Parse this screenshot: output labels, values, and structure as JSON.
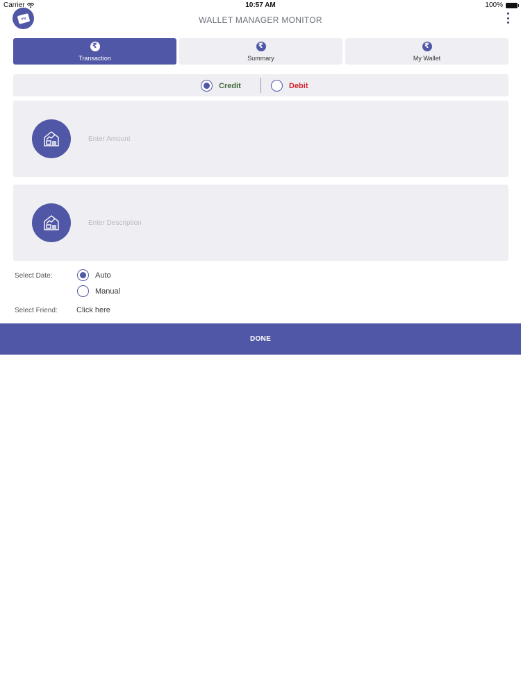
{
  "status_bar": {
    "carrier": "Carrier",
    "time": "10:57 AM",
    "battery": "100%",
    "wifi_icon": "wifi-icon",
    "battery_icon": "battery-icon"
  },
  "nav": {
    "logo_text": "my",
    "title": "WALLET MANAGER MONITOR",
    "menu_icon": "more-vertical-icon"
  },
  "tabs": [
    {
      "label": "Transaction",
      "icon": "rupee-icon",
      "icon_glyph": "₹",
      "active": true
    },
    {
      "label": "Summary",
      "icon": "rupee-icon",
      "icon_glyph": "₹",
      "active": false
    },
    {
      "label": "My Wallet",
      "icon": "rupee-icon",
      "icon_glyph": "₹",
      "active": false
    }
  ],
  "transaction_type": {
    "credit_label": "Credit",
    "debit_label": "Debit",
    "selected": "Credit",
    "credit_color": "#3f6b3a",
    "debit_color": "#d4232b"
  },
  "amount": {
    "placeholder": "Enter Amount",
    "value": "",
    "icon": "wallet-chart-icon"
  },
  "description": {
    "placeholder": "Enter Description",
    "value": "",
    "icon": "wallet-chart-icon"
  },
  "date": {
    "label": "Select Date:",
    "auto_label": "Auto",
    "manual_label": "Manual",
    "selected": "Auto"
  },
  "friend": {
    "label": "Select Friend:",
    "link_text": "Click here"
  },
  "done_button": {
    "label": "DONE"
  },
  "colors": {
    "accent": "#5057a6",
    "panel": "#efeff3",
    "background": "#ffffff"
  }
}
